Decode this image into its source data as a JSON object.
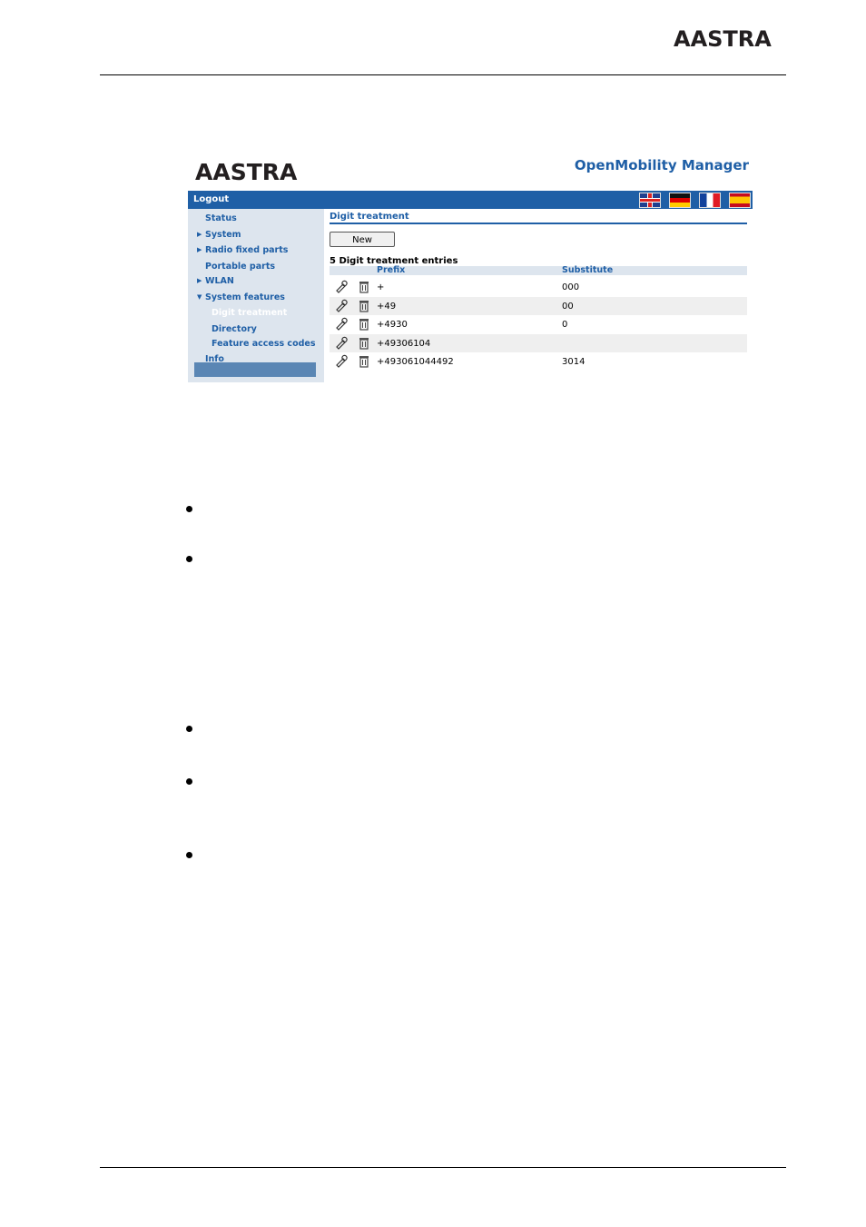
{
  "header": {
    "brand_logo": "AASTRA"
  },
  "app": {
    "logo": "AASTRA",
    "title": "OpenMobility Manager",
    "logout_label": "Logout",
    "languages": [
      "English",
      "German",
      "French",
      "Spanish"
    ]
  },
  "sidebar": {
    "items": [
      {
        "label": "Status"
      },
      {
        "label": "System",
        "arrow": "▶"
      },
      {
        "label": "Radio fixed parts",
        "arrow": "▶"
      },
      {
        "label": "Portable parts"
      },
      {
        "label": "WLAN",
        "arrow": "▶"
      },
      {
        "label": "System features",
        "arrow": "▼"
      },
      {
        "label": "Digit treatment",
        "active": true
      },
      {
        "label": "Directory"
      },
      {
        "label": "Feature access codes"
      },
      {
        "label": "Info"
      }
    ]
  },
  "main": {
    "section_title": "Digit treatment",
    "new_button": "New",
    "count_label": "5 Digit treatment entries",
    "columns": {
      "prefix": "Prefix",
      "substitute": "Substitute"
    },
    "rows": [
      {
        "prefix": "+",
        "substitute": "000"
      },
      {
        "prefix": "+49",
        "substitute": "00"
      },
      {
        "prefix": "+4930",
        "substitute": "0"
      },
      {
        "prefix": "+49306104",
        "substitute": ""
      },
      {
        "prefix": "+493061044492",
        "substitute": "3014"
      }
    ]
  },
  "colors": {
    "accent": "#1f5fa6",
    "sidebar_bg": "#dde5ee",
    "active_item": "#5a86b4"
  },
  "icons": {
    "edit": "edit-icon",
    "delete": "trash-icon"
  }
}
